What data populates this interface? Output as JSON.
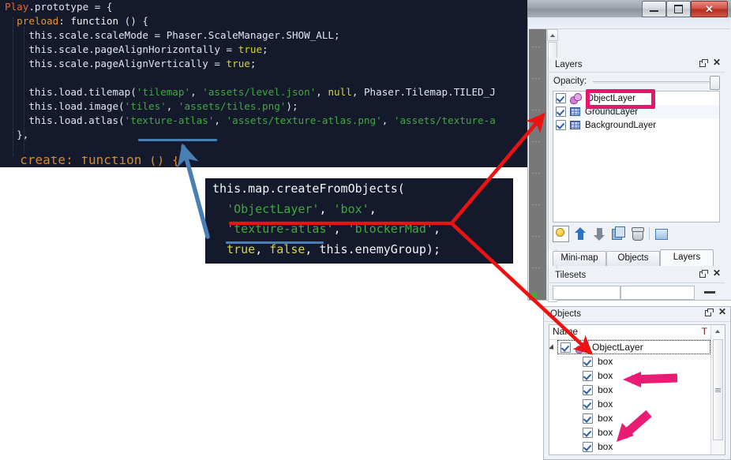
{
  "code_main": {
    "lines": [
      [
        {
          "t": "Play",
          "c": "cls"
        },
        {
          "t": ".prototype = {",
          "c": "plain"
        }
      ],
      [
        {
          "t": "  ",
          "c": "plain"
        },
        {
          "t": "preload",
          "c": "key"
        },
        {
          "t": ": ",
          "c": "plain"
        },
        {
          "t": "function",
          "c": "white"
        },
        {
          "t": " () {",
          "c": "plain"
        }
      ],
      [
        {
          "t": "    this.scale.scaleMode = Phaser.ScaleManager.SHOW_ALL;",
          "c": "plain"
        }
      ],
      [
        {
          "t": "    this.scale.pageAlignHorizontally = ",
          "c": "plain"
        },
        {
          "t": "true",
          "c": "bool"
        },
        {
          "t": ";",
          "c": "plain"
        }
      ],
      [
        {
          "t": "    this.scale.pageAlignVertically = ",
          "c": "plain"
        },
        {
          "t": "true",
          "c": "bool"
        },
        {
          "t": ";",
          "c": "plain"
        }
      ],
      [
        {
          "t": "",
          "c": "plain"
        }
      ],
      [
        {
          "t": "    this.load.tilemap(",
          "c": "plain"
        },
        {
          "t": "'tilemap'",
          "c": "str"
        },
        {
          "t": ", ",
          "c": "plain"
        },
        {
          "t": "'assets/level.json'",
          "c": "str"
        },
        {
          "t": ", ",
          "c": "plain"
        },
        {
          "t": "null",
          "c": "null"
        },
        {
          "t": ", Phaser.Tilemap.TILED_J",
          "c": "plain"
        }
      ],
      [
        {
          "t": "    this.load.image(",
          "c": "plain"
        },
        {
          "t": "'tiles'",
          "c": "str"
        },
        {
          "t": ", ",
          "c": "plain"
        },
        {
          "t": "'assets/tiles.png'",
          "c": "str"
        },
        {
          "t": ");",
          "c": "plain"
        }
      ],
      [
        {
          "t": "    this.load.atlas(",
          "c": "plain"
        },
        {
          "t": "'texture-atlas'",
          "c": "str"
        },
        {
          "t": ", ",
          "c": "plain"
        },
        {
          "t": "'assets/texture-atlas.png'",
          "c": "str"
        },
        {
          "t": ", ",
          "c": "plain"
        },
        {
          "t": "'assets/texture-a",
          "c": "str"
        }
      ],
      [
        {
          "t": "  },",
          "c": "plain"
        }
      ]
    ],
    "cut_line": [
      {
        "t": "  create: function () {",
        "c": "key"
      }
    ]
  },
  "code_callout": {
    "lines": [
      [
        {
          "t": "this.map.createFromObjects(",
          "c": "white"
        }
      ],
      [
        {
          "t": "  ",
          "c": "plain"
        },
        {
          "t": "'ObjectLayer'",
          "c": "str"
        },
        {
          "t": ", ",
          "c": "white"
        },
        {
          "t": "'box'",
          "c": "str"
        },
        {
          "t": ",",
          "c": "white"
        }
      ],
      [
        {
          "t": "  ",
          "c": "plain"
        },
        {
          "t": "'texture-atlas'",
          "c": "str"
        },
        {
          "t": ", ",
          "c": "white"
        },
        {
          "t": "'blockerMad'",
          "c": "str"
        },
        {
          "t": ",",
          "c": "white"
        }
      ],
      [
        {
          "t": "  ",
          "c": "plain"
        },
        {
          "t": "true",
          "c": "bool"
        },
        {
          "t": ", ",
          "c": "white"
        },
        {
          "t": "false",
          "c": "bool"
        },
        {
          "t": ", this.enemyGroup);",
          "c": "white"
        }
      ]
    ]
  },
  "window": {
    "buttons": {
      "minimize": "minimize-button",
      "maximize": "maximize-button",
      "close_label": "✕"
    }
  },
  "layers_panel": {
    "title": "Layers",
    "close_label": "✕",
    "opacity_label": "Opacity:",
    "items": [
      {
        "label": "ObjectLayer",
        "checked": true,
        "icon": "object-layer-icon"
      },
      {
        "label": "GroundLayer",
        "checked": true,
        "icon": "tile-layer-icon"
      },
      {
        "label": "BackgroundLayer",
        "checked": true,
        "icon": "tile-layer-icon"
      }
    ],
    "toolbar": [
      {
        "name": "new-layer-button"
      },
      {
        "name": "raise-layer-button"
      },
      {
        "name": "lower-layer-button"
      },
      {
        "name": "duplicate-layer-button"
      },
      {
        "name": "delete-layer-button"
      },
      {
        "name": "layer-properties-button"
      }
    ]
  },
  "dock_tabs": [
    {
      "label": "Mini-map",
      "active": false
    },
    {
      "label": "Objects",
      "active": false
    },
    {
      "label": "Layers",
      "active": true
    }
  ],
  "tilesets_panel": {
    "title": "Tilesets",
    "close_label": "✕"
  },
  "objects_panel": {
    "title": "Objects",
    "close_label": "✕",
    "column_name": "Name",
    "column_type": "T",
    "root": {
      "label": "ObjectLayer",
      "checked": true
    },
    "children": [
      {
        "label": "box",
        "checked": true
      },
      {
        "label": "box",
        "checked": true
      },
      {
        "label": "box",
        "checked": true
      },
      {
        "label": "box",
        "checked": true
      },
      {
        "label": "box",
        "checked": true
      },
      {
        "label": "box",
        "checked": true
      },
      {
        "label": "box",
        "checked": true
      }
    ]
  },
  "annotations": {
    "highlight_color": "#e8146e",
    "red_arrow_color": "#ee1111",
    "blue_arrow_color": "#4a7fb5"
  }
}
